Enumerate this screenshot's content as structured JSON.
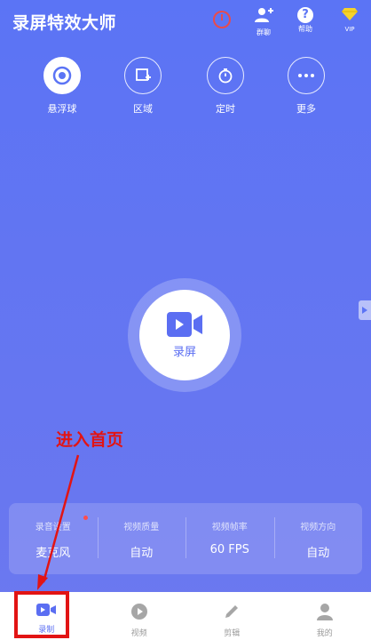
{
  "app": {
    "title": "录屏特效大师"
  },
  "header": {
    "group_label": "群聊",
    "help_label": "帮助",
    "help_glyph": "?",
    "vip_label": "VIP"
  },
  "tools": [
    {
      "label": "悬浮球",
      "icon": "floating-ball-icon"
    },
    {
      "label": "区域",
      "icon": "region-icon"
    },
    {
      "label": "定时",
      "icon": "timer-icon"
    },
    {
      "label": "更多",
      "icon": "more-icon"
    }
  ],
  "record": {
    "label": "录屏"
  },
  "annotation": {
    "text": "进入首页",
    "color": "#e21414"
  },
  "settings": [
    {
      "key": "录音设置",
      "value": "麦克风"
    },
    {
      "key": "视频质量",
      "value": "自动"
    },
    {
      "key": "视频帧率",
      "value": "60 FPS"
    },
    {
      "key": "视频方向",
      "value": "自动"
    }
  ],
  "tabs": [
    {
      "label": "录制",
      "active": true
    },
    {
      "label": "视频",
      "active": false
    },
    {
      "label": "剪辑",
      "active": false
    },
    {
      "label": "我的",
      "active": false
    }
  ],
  "colors": {
    "accent": "#5b74f5",
    "active_tab": "#5b6ef2",
    "annotation_red": "#e21414"
  }
}
